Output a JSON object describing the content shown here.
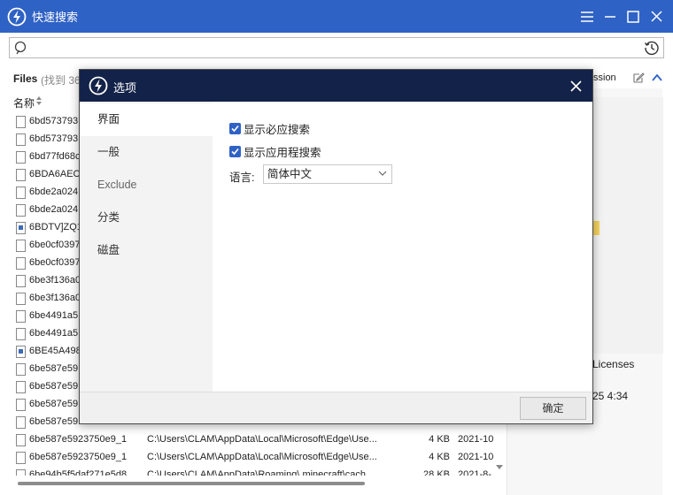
{
  "app": {
    "title": "快速搜索"
  },
  "search": {
    "value": "",
    "placeholder": ""
  },
  "files_header": {
    "title": "Files",
    "count": "(找到 36",
    "right_label": "ssion"
  },
  "columns": {
    "name": "名称"
  },
  "files": [
    {
      "name": "6bd573793",
      "path": "",
      "size": "",
      "date": "",
      "icon": "doc"
    },
    {
      "name": "6bd573793",
      "path": "",
      "size": "",
      "date": "",
      "icon": "doc"
    },
    {
      "name": "6bd77fd68c",
      "path": "",
      "size": "",
      "date": "",
      "icon": "doc"
    },
    {
      "name": "6BDA6AEC-",
      "path": "",
      "size": "",
      "date": "",
      "icon": "doc"
    },
    {
      "name": "6bde2a024",
      "path": "",
      "size": "",
      "date": "",
      "icon": "doc"
    },
    {
      "name": "6bde2a024",
      "path": "",
      "size": "",
      "date": "",
      "icon": "doc"
    },
    {
      "name": "6BDTV]ZQ1",
      "path": "",
      "size": "",
      "date": "",
      "icon": "image"
    },
    {
      "name": "6be0cf0397",
      "path": "",
      "size": "",
      "date": "",
      "icon": "doc"
    },
    {
      "name": "6be0cf0397",
      "path": "",
      "size": "",
      "date": "",
      "icon": "doc"
    },
    {
      "name": "6be3f136a0",
      "path": "",
      "size": "",
      "date": "",
      "icon": "doc"
    },
    {
      "name": "6be3f136a0",
      "path": "",
      "size": "",
      "date": "",
      "icon": "doc"
    },
    {
      "name": "6be4491a5",
      "path": "",
      "size": "",
      "date": "",
      "icon": "doc"
    },
    {
      "name": "6be4491a5",
      "path": "",
      "size": "",
      "date": "",
      "icon": "doc"
    },
    {
      "name": "6BE45A498",
      "path": "",
      "size": "",
      "date": "",
      "icon": "image"
    },
    {
      "name": "6be587e59",
      "path": "",
      "size": "",
      "date": "",
      "icon": "doc"
    },
    {
      "name": "6be587e59",
      "path": "",
      "size": "",
      "date": "",
      "icon": "doc"
    },
    {
      "name": "6be587e59",
      "path": "",
      "size": "",
      "date": "",
      "icon": "doc"
    },
    {
      "name": "6be587e59",
      "path": "",
      "size": "",
      "date": "",
      "icon": "doc"
    },
    {
      "name": "6be587e5923750e9_1",
      "path": "C:\\Users\\CLAM\\AppData\\Local\\Microsoft\\Edge\\Use...",
      "size": "4 KB",
      "date": "2021-10",
      "icon": "doc"
    },
    {
      "name": "6be587e5923750e9_1",
      "path": "C:\\Users\\CLAM\\AppData\\Local\\Microsoft\\Edge\\Use...",
      "size": "4 KB",
      "date": "2021-10",
      "icon": "doc"
    },
    {
      "name": "6be94b5f5daf271e5d8",
      "path": "C:\\Users\\CLAM\\AppData\\Roaming\\.minecraft\\cach",
      "size": "28 KB",
      "date": "2021-8-",
      "icon": "doc"
    }
  ],
  "preview": {
    "line1": "Licenses",
    "line2": "25 4:34"
  },
  "dialog": {
    "title": "选项",
    "nav": [
      {
        "label": "界面",
        "active": true
      },
      {
        "label": "一般",
        "active": false
      },
      {
        "label": "Exclude",
        "active": false
      },
      {
        "label": "分类",
        "active": false
      },
      {
        "label": "磁盘",
        "active": false
      }
    ],
    "options": {
      "show_required_search": {
        "label": "显示必应搜索",
        "checked": true
      },
      "show_app_search": {
        "label": "显示应用程搜索",
        "checked": true
      }
    },
    "language": {
      "label": "语言:",
      "value": "简体中文"
    },
    "ok_label": "确定"
  },
  "colors": {
    "titlebar": "#2f62c5",
    "dialog_titlebar": "#132248",
    "checkbox": "#2f62c5"
  }
}
